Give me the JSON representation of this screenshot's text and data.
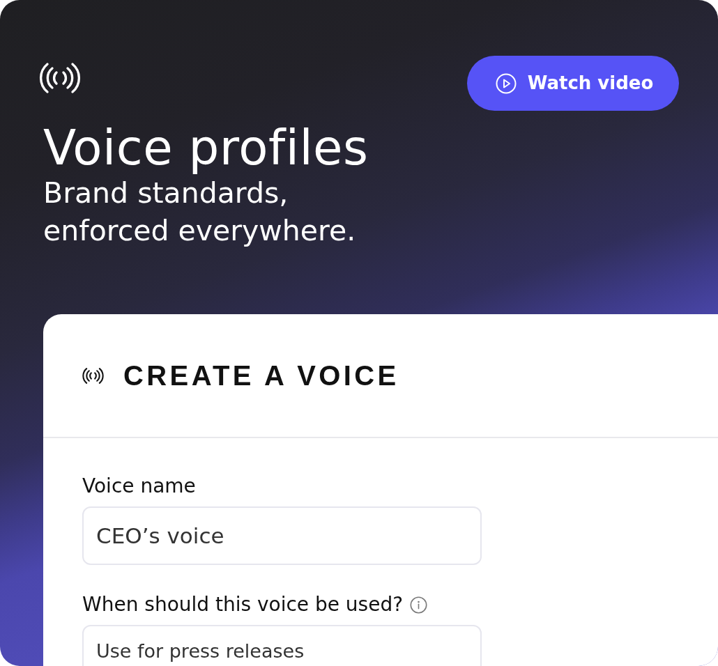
{
  "header": {
    "title": "Voice profiles",
    "subtitle": "Brand standards, enforced everywhere.",
    "watch_button": {
      "label": "Watch video"
    }
  },
  "form": {
    "title": "CREATE A VOICE",
    "fields": [
      {
        "label": "Voice name",
        "kind": "input",
        "value": "CEO’s voice",
        "info": false
      },
      {
        "label": "When should this voice be used?",
        "kind": "textarea",
        "value": "Use for press releases",
        "info": true
      }
    ]
  }
}
